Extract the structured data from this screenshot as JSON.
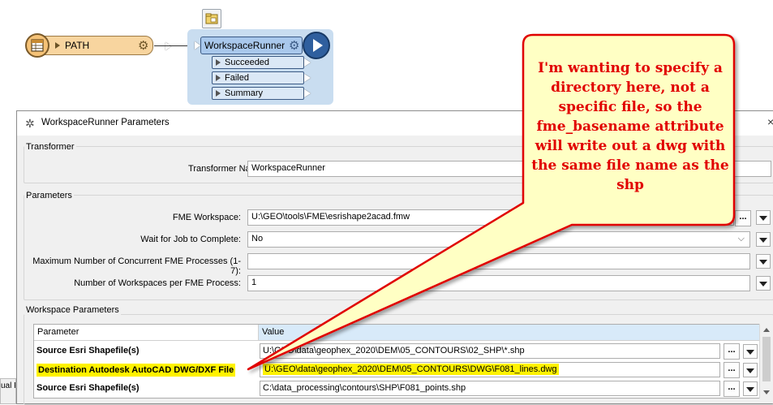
{
  "canvas": {
    "path_node": {
      "label": "PATH"
    },
    "workspace_runner": {
      "title": "WorkspaceRunner",
      "ports": [
        "Succeeded",
        "Failed",
        "Summary"
      ]
    }
  },
  "dialog": {
    "title": "WorkspaceRunner Parameters",
    "transformer_group": {
      "label": "Transformer",
      "name_label": "Transformer Name:",
      "name_value": "WorkspaceRunner"
    },
    "parameters_group": {
      "label": "Parameters",
      "fme_workspace_label": "FME Workspace:",
      "fme_workspace_value": "U:\\GEO\\tools\\FME\\esrishape2acad.fmw",
      "wait_label": "Wait for Job to Complete:",
      "wait_value": "No",
      "max_processes_label": "Maximum Number of Concurrent FME Processes (1-7):",
      "max_processes_value": "",
      "workspaces_per_process_label": "Number of Workspaces per FME Process:",
      "workspaces_per_process_value": "1"
    },
    "workspace_params_group": {
      "label": "Workspace Parameters",
      "columns": [
        "Parameter",
        "Value"
      ],
      "rows": [
        {
          "parameter": "Source Esri Shapefile(s)",
          "value": "U:\\GEO\\data\\geophex_2020\\DEM\\05_CONTOURS\\02_SHP\\*.shp"
        },
        {
          "parameter": "Destination Autodesk AutoCAD DWG/DXF File",
          "value": "U:\\GEO\\data\\geophex_2020\\DEM\\05_CONTOURS\\DWG\\F081_lines.dwg"
        },
        {
          "parameter": "Source Esri Shapefile(s)",
          "value": "C:\\data_processing\\contours\\SHP\\F081_points.shp"
        }
      ]
    },
    "dots_label": "...",
    "close_label": "×"
  },
  "behind_window_text": "ual F",
  "callout": {
    "text": "I'm wanting to specify a directory here, not a specific file, so the fme_basename attribute will write out a dwg with the same file name as the shp",
    "border_color": "#e00000",
    "fill_color": "#ffffc4",
    "text_color": "#e10000"
  },
  "colors": {
    "highlight": "#fff200",
    "accent": "#2f5f9e"
  }
}
